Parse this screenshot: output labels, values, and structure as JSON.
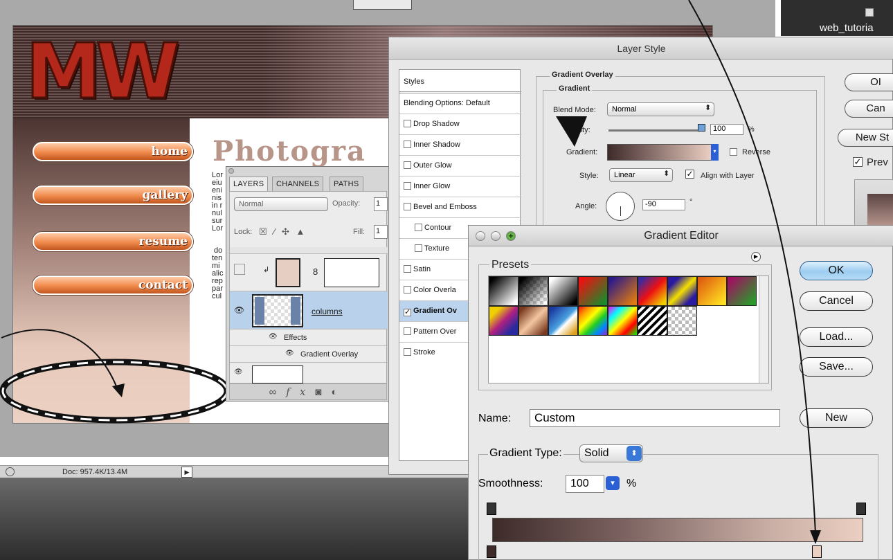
{
  "finder": {
    "item_label": "web_tutoria"
  },
  "site": {
    "logo": "MW",
    "title": "Photogra",
    "nav": [
      "home",
      "gallery",
      "resume",
      "contact"
    ],
    "lorem_lines": [
      "Lor",
      "eiu",
      "eni",
      "nis",
      "in r",
      "nul",
      "sur",
      "Lor",
      "",
      "do",
      "ten",
      "mi",
      "alic",
      "rep",
      "par",
      "cul"
    ]
  },
  "status_bar": {
    "doc": "Doc: 957.4K/13.4M"
  },
  "layers_panel": {
    "tabs": [
      "LAYERS",
      "CHANNELS",
      "PATHS"
    ],
    "blend_mode": "Normal",
    "opacity_label": "Opacity:",
    "opacity_value": "1",
    "lock_label": "Lock:",
    "fill_label": "Fill:",
    "fill_value": "1",
    "layer_name": "columns",
    "effects_label": "Effects",
    "effect_item": "Gradient Overlay",
    "footer_icons": [
      "link-icon",
      "fx-icon",
      "mask-icon",
      "adjustment-icon"
    ],
    "footer_fx": "fx"
  },
  "layer_style": {
    "title": "Layer Style",
    "styles_header": "Styles",
    "blending_options": "Blending Options: Default",
    "items": [
      {
        "label": "Drop Shadow",
        "checked": false,
        "indent": false
      },
      {
        "label": "Inner Shadow",
        "checked": false,
        "indent": false
      },
      {
        "label": "Outer Glow",
        "checked": false,
        "indent": false
      },
      {
        "label": "Inner Glow",
        "checked": false,
        "indent": false
      },
      {
        "label": "Bevel and Emboss",
        "checked": false,
        "indent": false
      },
      {
        "label": "Contour",
        "checked": false,
        "indent": true
      },
      {
        "label": "Texture",
        "checked": false,
        "indent": true
      },
      {
        "label": "Satin",
        "checked": false,
        "indent": false
      },
      {
        "label": "Color Overla",
        "checked": false,
        "indent": false
      },
      {
        "label": "Gradient Ov",
        "checked": true,
        "indent": false
      },
      {
        "label": "Pattern Over",
        "checked": false,
        "indent": false
      },
      {
        "label": "Stroke",
        "checked": false,
        "indent": false
      }
    ],
    "group_title": "Gradient Overlay",
    "subgroup_title": "Gradient",
    "blend_mode_label": "Blend Mode:",
    "blend_mode_value": "Normal",
    "opacity_label": "acity:",
    "opacity_value": "100",
    "percent": "%",
    "gradient_label": "Gradient:",
    "reverse_label": "Reverse",
    "style_label": "Style:",
    "style_value": "Linear",
    "align_label": "Align with Layer",
    "angle_label": "Angle:",
    "angle_value": "-90",
    "degree": "°",
    "buttons": {
      "ok": "OI",
      "cancel": "Can",
      "new_style": "New St",
      "preview": "Prev"
    }
  },
  "gradient_editor": {
    "title": "Gradient Editor",
    "presets_label": "Presets",
    "buttons": {
      "ok": "OK",
      "cancel": "Cancel",
      "load": "Load...",
      "save": "Save...",
      "new": "New"
    },
    "name_label": "Name:",
    "name_value": "Custom",
    "type_label": "Gradient Type:",
    "type_value": "Solid",
    "smoothness_label": "Smoothness:",
    "smoothness_value": "100",
    "percent": "%",
    "gradient_colors": [
      "#3d2b2a",
      "#ebcfc2"
    ]
  }
}
